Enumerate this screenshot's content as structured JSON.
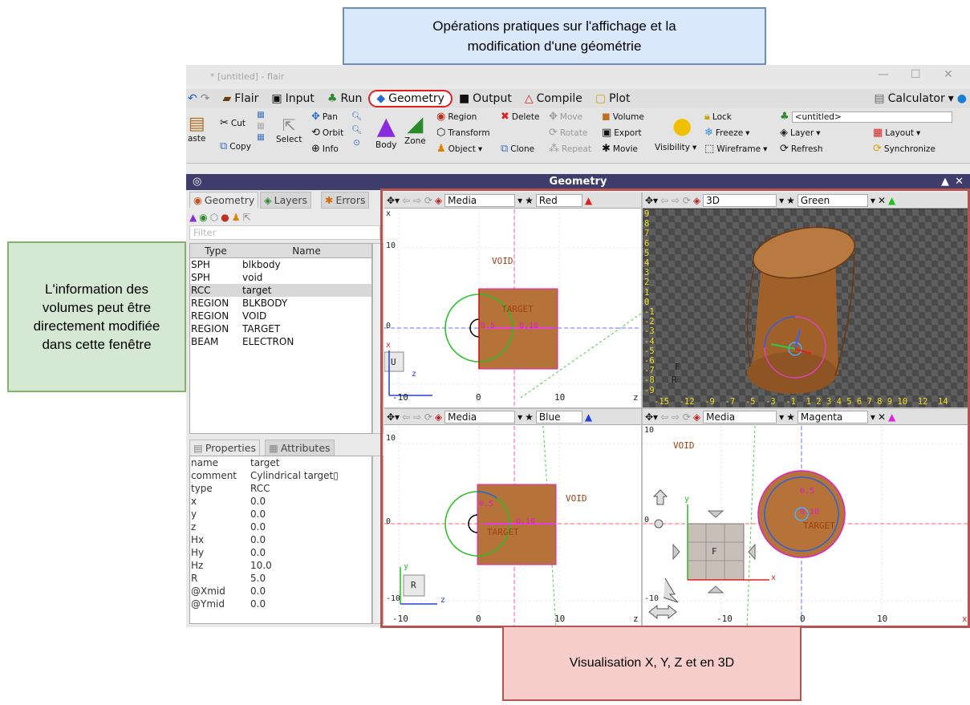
{
  "callouts": {
    "top_line1": "Opérations pratiques sur l'affichage et la",
    "top_line2": "modification d'une géométrie",
    "left_line1": "L'information des",
    "left_line2": "volumes peut être",
    "left_line3": "directement modifiée",
    "left_line4": "dans cette fenêtre",
    "bottom": "Visualisation X, Y, Z et en 3D"
  },
  "window": {
    "title": "* [untitled] - flair"
  },
  "menu": {
    "flair": "Flair",
    "input": "Input",
    "run": "Run",
    "geometry": "Geometry",
    "output": "Output",
    "compile": "Compile",
    "plot": "Plot",
    "calculator": "Calculator"
  },
  "ribbon": {
    "paste": "aste",
    "cut": "Cut",
    "copy": "Copy",
    "select": "Select",
    "pan": "Pan",
    "orbit": "Orbit",
    "info": "Info",
    "body": "Body",
    "zone": "Zone",
    "region": "Region",
    "transform": "Transform",
    "object": "Object",
    "delete": "Delete",
    "clone": "Clone",
    "move": "Move",
    "rotate": "Rotate",
    "repeat": "Repeat",
    "volume": "Volume",
    "export": "Export",
    "movie": "Movie",
    "visibility": "Visibility",
    "lock": "Lock",
    "freeze": "Freeze",
    "wireframe": "Wireframe",
    "untitled": "<untitled>",
    "layer": "Layer",
    "layout": "Layout",
    "refresh": "Refresh",
    "synchronize": "Synchronize"
  },
  "geometry_bar": {
    "title": "Geometry"
  },
  "left_panel": {
    "tabs": {
      "geometry": "Geometry",
      "layers": "Layers",
      "errors": "Errors"
    },
    "filter_placeholder": "Filter",
    "list_headers": {
      "type": "Type",
      "name": "Name"
    },
    "list_rows": [
      {
        "type": "SPH",
        "name": "blkbody"
      },
      {
        "type": "SPH",
        "name": "void"
      },
      {
        "type": "RCC",
        "name": "target"
      },
      {
        "type": "REGION",
        "name": "BLKBODY"
      },
      {
        "type": "REGION",
        "name": "VOID"
      },
      {
        "type": "REGION",
        "name": "TARGET"
      },
      {
        "type": "BEAM",
        "name": "ELECTRON"
      }
    ],
    "prop_tabs": {
      "properties": "Properties",
      "attributes": "Attributes"
    },
    "properties": [
      {
        "key": "name",
        "value": "target"
      },
      {
        "key": "comment",
        "value": "Cylindrical target▯"
      },
      {
        "key": "type",
        "value": "RCC"
      },
      {
        "key": "x",
        "value": "0.0"
      },
      {
        "key": "y",
        "value": "0.0"
      },
      {
        "key": "z",
        "value": "0.0"
      },
      {
        "key": "Hx",
        "value": "0.0"
      },
      {
        "key": "Hy",
        "value": "0.0"
      },
      {
        "key": "Hz",
        "value": "10.0"
      },
      {
        "key": "R",
        "value": "5.0"
      },
      {
        "key": "@Xmid",
        "value": "0.0"
      },
      {
        "key": "@Ymid",
        "value": "0.0"
      }
    ]
  },
  "viewports": {
    "red": {
      "layer": "Media",
      "name": "Red",
      "color": "#e02020",
      "void": "VOID",
      "target": "TARGET",
      "tick_n10": "-10",
      "tick_0": "0",
      "tick_10": "10",
      "ytick_10": "10",
      "ytick_0": "0",
      "ax_x": "x",
      "ax_z": "z",
      "cube_face": "U",
      "lbl_a": "0.5",
      "lbl_b": "0.10",
      "corner": "z"
    },
    "green": {
      "layer": "3D",
      "name": "Green",
      "color": "#20c020",
      "yticks": [
        "9",
        "8",
        "7",
        "6",
        "5",
        "4",
        "3",
        "2",
        "1",
        "0",
        "-1",
        "-2",
        "-3",
        "-4",
        "-5",
        "-6",
        "-7",
        "-8",
        "-9"
      ],
      "xticks": "-15  -12  -9  -7  -5  -3  -1  1 2 3 4 5 6 7 8 9 10  12  14",
      "cube_f": "F",
      "cube_r": "R"
    },
    "blue": {
      "layer": "Media",
      "name": "Blue",
      "color": "#2040e0",
      "void": "VOID",
      "target": "TARGET",
      "tick_n10": "-10",
      "tick_0": "0",
      "tick_10": "10",
      "ytick_10": "10",
      "ytick_0": "0",
      "ytick_n10": "-10",
      "ax_y": "y",
      "ax_z": "z",
      "cube_face": "R",
      "lbl_a": "0.5",
      "lbl_b": "0.10",
      "corner": "z"
    },
    "magenta": {
      "layer": "Media",
      "name": "Magenta",
      "color": "#e020e0",
      "void": "VOID",
      "target": "TARGET",
      "tick_n10": "-10",
      "tick_0": "0",
      "tick_10": "10",
      "ytick_10": "10",
      "ytick_0": "0",
      "ytick_n10": "-10",
      "ax_y": "y",
      "ax_x": "x",
      "cube_face": "F",
      "lbl_a": "0.5",
      "lbl_b": "0.10",
      "corner": "x"
    }
  }
}
